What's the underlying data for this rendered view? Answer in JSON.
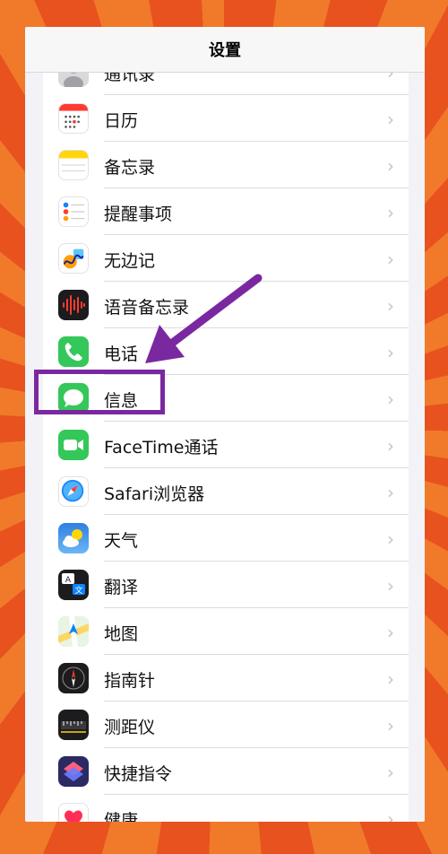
{
  "nav": {
    "title": "设置"
  },
  "items": [
    {
      "label": "通讯录",
      "icon": "contacts-icon",
      "color": "#d9d9dd"
    },
    {
      "label": "日历",
      "icon": "calendar-icon",
      "color": "#ffffff"
    },
    {
      "label": "备忘录",
      "icon": "notes-icon",
      "color": "#ffffff"
    },
    {
      "label": "提醒事项",
      "icon": "reminders-icon",
      "color": "#ffffff"
    },
    {
      "label": "无边记",
      "icon": "freeform-icon",
      "color": "#ffffff"
    },
    {
      "label": "语音备忘录",
      "icon": "voice-memos-icon",
      "color": "#1c1c1e"
    },
    {
      "label": "电话",
      "icon": "phone-icon",
      "color": "#34c759"
    },
    {
      "label": "信息",
      "icon": "messages-icon",
      "color": "#34c759"
    },
    {
      "label": "FaceTime通话",
      "icon": "facetime-icon",
      "color": "#34c759"
    },
    {
      "label": "Safari浏览器",
      "icon": "safari-icon",
      "color": "#ffffff"
    },
    {
      "label": "天气",
      "icon": "weather-icon",
      "color": "#3d8ee6"
    },
    {
      "label": "翻译",
      "icon": "translate-icon",
      "color": "#1c1c1e"
    },
    {
      "label": "地图",
      "icon": "maps-icon",
      "color": "#8fd19e"
    },
    {
      "label": "指南针",
      "icon": "compass-icon",
      "color": "#1c1c1e"
    },
    {
      "label": "测距仪",
      "icon": "measure-icon",
      "color": "#1c1c1e"
    },
    {
      "label": "快捷指令",
      "icon": "shortcuts-icon",
      "color": "#2b2a63"
    },
    {
      "label": "健康",
      "icon": "health-icon",
      "color": "#ffffff"
    }
  ],
  "chevron": "›",
  "annotation": {
    "color": "#7a28a0"
  }
}
